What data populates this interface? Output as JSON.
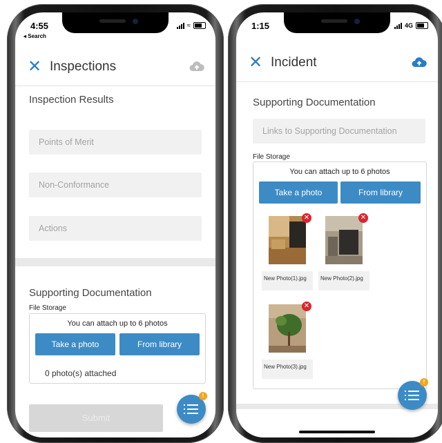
{
  "left": {
    "status": {
      "time": "4:55",
      "back_label": "◂ Search"
    },
    "title": "Inspections",
    "results_title": "Inspection Results",
    "fields": [
      {
        "placeholder": "Points of Merit"
      },
      {
        "placeholder": "Non-Conformance"
      },
      {
        "placeholder": "Actions"
      }
    ],
    "supporting_title": "Supporting Documentation",
    "file_storage_label": "File Storage",
    "attach_note": "You can attach up to 6 photos",
    "take_photo": "Take a photo",
    "from_library": "From library",
    "photo_count": "0 photo(s) attached",
    "submit": "Submit",
    "fab_badge": "!"
  },
  "right": {
    "status": {
      "time": "1:15",
      "network": "4G"
    },
    "title": "Incident",
    "supporting_title": "Supporting Documentation",
    "links_placeholder": "Links to Supporting Documentation",
    "file_storage_label": "File Storage",
    "attach_note": "You can attach up to 6 photos",
    "take_photo": "Take a photo",
    "from_library": "From library",
    "photos": [
      {
        "name": "New Photo(1).jpg"
      },
      {
        "name": "New Photo(2).jpg"
      },
      {
        "name": "New Photo(3).jpg"
      }
    ],
    "fab_badge": "!"
  },
  "colors": {
    "accent": "#3d8bc5",
    "close_icon": "#2b7bc8",
    "remove_badge": "#d9262f",
    "notification_badge": "#f3a51d"
  },
  "icons": [
    "close-icon",
    "cloud-upload-icon",
    "list-icon",
    "remove-photo-icon",
    "wifi-icon",
    "signal-icon",
    "battery-icon"
  ]
}
